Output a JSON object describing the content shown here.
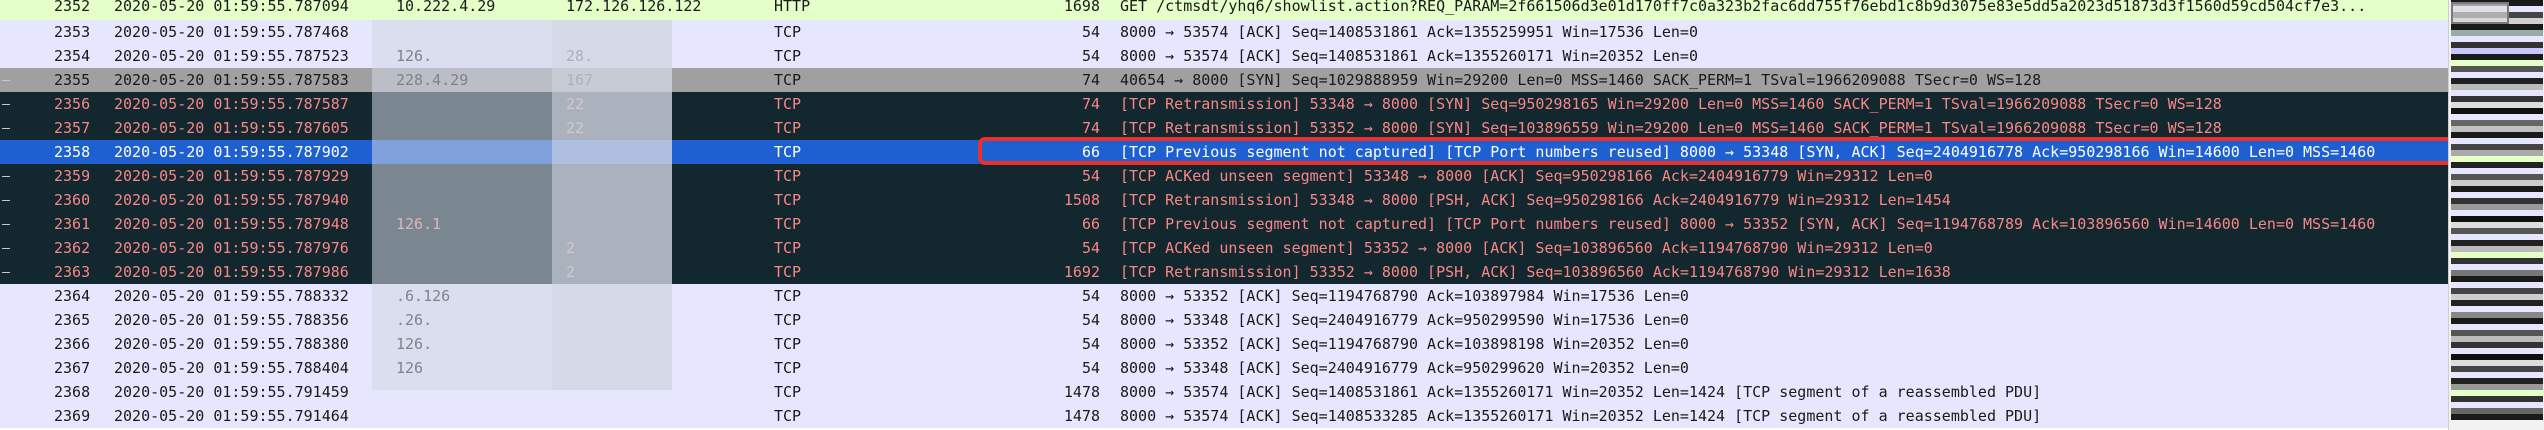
{
  "packets": [
    {
      "no": "2352",
      "time": "2020-05-20 01:59:55.787094",
      "src": "10.222.4.29",
      "dst": "172.126.126.122",
      "proto": "HTTP",
      "len": "1698",
      "info": "GET /ctmsdt/yhq6/showlist.action?REQ_PARAM=2f661506d3e01d170ff7c0a323b2fac6dd755f76ebd1c8b9d3075e83e5dd5a2023d51873d3f1560d59cd504cf7e3...",
      "style": "http"
    },
    {
      "no": "2353",
      "time": "2020-05-20 01:59:55.787468",
      "src": "",
      "dst": "",
      "proto": "TCP",
      "len": "54",
      "info": "8000 → 53574 [ACK] Seq=1408531861 Ack=1355259951 Win=17536 Len=0",
      "style": "tcp"
    },
    {
      "no": "2354",
      "time": "2020-05-20 01:59:55.787523",
      "src": "126.",
      "dst": "28.",
      "proto": "TCP",
      "len": "54",
      "info": "8000 → 53574 [ACK] Seq=1408531861 Ack=1355260171 Win=20352 Len=0",
      "style": "tcp"
    },
    {
      "no": "2355",
      "time": "2020-05-20 01:59:55.787583",
      "src": "228.4.29",
      "dst": "167",
      "proto": "TCP",
      "len": "74",
      "info": "40654 → 8000 [SYN] Seq=1029888959 Win=29200 Len=0 MSS=1460 SACK_PERM=1 TSval=1966209088 TSecr=0 WS=128",
      "style": "syn"
    },
    {
      "no": "2356",
      "time": "2020-05-20 01:59:55.787587",
      "src": "",
      "dst": "22",
      "proto": "TCP",
      "len": "74",
      "info": "[TCP Retransmission] 53348 → 8000 [SYN] Seq=950298165 Win=29200 Len=0 MSS=1460 SACK_PERM=1 TSval=1966209088 TSecr=0 WS=128",
      "style": "bad"
    },
    {
      "no": "2357",
      "time": "2020-05-20 01:59:55.787605",
      "src": "",
      "dst": "22",
      "proto": "TCP",
      "len": "74",
      "info": "[TCP Retransmission] 53352 → 8000 [SYN] Seq=103896559 Win=29200 Len=0 MSS=1460 SACK_PERM=1 TSval=1966209088 TSecr=0 WS=128",
      "style": "bad"
    },
    {
      "no": "2358",
      "time": "2020-05-20 01:59:55.787902",
      "src": "",
      "dst": "",
      "proto": "TCP",
      "len": "66",
      "info": "[TCP Previous segment not captured] [TCP Port numbers reused] 8000 → 53348 [SYN, ACK] Seq=2404916778 Ack=950298166 Win=14600 Len=0 MSS=1460",
      "style": "sel"
    },
    {
      "no": "2359",
      "time": "2020-05-20 01:59:55.787929",
      "src": "",
      "dst": "",
      "proto": "TCP",
      "len": "54",
      "info": "[TCP ACKed unseen segment] 53348 → 8000 [ACK] Seq=950298166 Ack=2404916779 Win=29312 Len=0",
      "style": "bad"
    },
    {
      "no": "2360",
      "time": "2020-05-20 01:59:55.787940",
      "src": "",
      "dst": "",
      "proto": "TCP",
      "len": "1508",
      "info": "[TCP Retransmission] 53348 → 8000 [PSH, ACK] Seq=950298166 Ack=2404916779 Win=29312 Len=1454",
      "style": "bad"
    },
    {
      "no": "2361",
      "time": "2020-05-20 01:59:55.787948",
      "src": "126.1",
      "dst": "",
      "proto": "TCP",
      "len": "66",
      "info": "[TCP Previous segment not captured] [TCP Port numbers reused] 8000 → 53352 [SYN, ACK] Seq=1194768789 Ack=103896560 Win=14600 Len=0 MSS=1460",
      "style": "bad"
    },
    {
      "no": "2362",
      "time": "2020-05-20 01:59:55.787976",
      "src": "",
      "dst": "2",
      "proto": "TCP",
      "len": "54",
      "info": "[TCP ACKed unseen segment] 53352 → 8000 [ACK] Seq=103896560 Ack=1194768790 Win=29312 Len=0",
      "style": "bad"
    },
    {
      "no": "2363",
      "time": "2020-05-20 01:59:55.787986",
      "src": "",
      "dst": "2",
      "proto": "TCP",
      "len": "1692",
      "info": "[TCP Retransmission] 53352 → 8000 [PSH, ACK] Seq=103896560 Ack=1194768790 Win=29312 Len=1638",
      "style": "bad"
    },
    {
      "no": "2364",
      "time": "2020-05-20 01:59:55.788332",
      "src": ".6.126",
      "dst": "",
      "proto": "TCP",
      "len": "54",
      "info": "8000 → 53352 [ACK] Seq=1194768790 Ack=103897984 Win=17536 Len=0",
      "style": "tcp"
    },
    {
      "no": "2365",
      "time": "2020-05-20 01:59:55.788356",
      "src": ".26.",
      "dst": "",
      "proto": "TCP",
      "len": "54",
      "info": "8000 → 53348 [ACK] Seq=2404916779 Ack=950299590 Win=17536 Len=0",
      "style": "tcp"
    },
    {
      "no": "2366",
      "time": "2020-05-20 01:59:55.788380",
      "src": "126.",
      "dst": "",
      "proto": "TCP",
      "len": "54",
      "info": "8000 → 53352 [ACK] Seq=1194768790 Ack=103898198 Win=20352 Len=0",
      "style": "tcp"
    },
    {
      "no": "2367",
      "time": "2020-05-20 01:59:55.788404",
      "src": "126",
      "dst": "",
      "proto": "TCP",
      "len": "54",
      "info": "8000 → 53348 [ACK] Seq=2404916779 Ack=950299620 Win=20352 Len=0",
      "style": "tcp"
    },
    {
      "no": "2368",
      "time": "2020-05-20 01:59:55.791459",
      "src": "",
      "dst": "",
      "proto": "TCP",
      "len": "1478",
      "info": "8000 → 53574 [ACK] Seq=1408531861 Ack=1355260171 Win=20352 Len=1424 [TCP segment of a reassembled PDU]",
      "style": "tcp"
    },
    {
      "no": "2369",
      "time": "2020-05-20 01:59:55.791464",
      "src": "",
      "dst": "",
      "proto": "TCP",
      "len": "1478",
      "info": "8000 → 53574 [ACK] Seq=1408533285 Ack=1355260171 Win=20352 Len=1424 [TCP segment of a reassembled PDU]",
      "style": "tcp"
    }
  ],
  "colors": {
    "http": "#e4ffc7",
    "tcp": "#e7e6ff",
    "syn": "#a0a0a0",
    "bad": "#12272e",
    "bad_text": "#f78787",
    "selected": "#1e5fd2",
    "highlight_box": "#e8312a"
  },
  "minimap_pattern": [
    "#1a1a1a",
    "#e7e6ff",
    "#444",
    "#d0d0d0",
    "#1a1a1a",
    "#9aa",
    "#e7e6ff",
    "#333",
    "#c8c8ff",
    "#1a1a1a",
    "#e4ffc7",
    "#555",
    "#e7e6ff",
    "#222",
    "#bbb",
    "#e7e6ff",
    "#333",
    "#ddd",
    "#111",
    "#e7e6ff",
    "#666",
    "#c0c0c0",
    "#1a1a1a",
    "#e7e6ff",
    "#444",
    "#aaa",
    "#e4ffc7",
    "#222",
    "#e7e6ff",
    "#555",
    "#ccc",
    "#1a1a1a",
    "#e7e6ff",
    "#333",
    "#999",
    "#e7e6ff",
    "#111",
    "#ddd",
    "#555",
    "#e7e6ff",
    "#222",
    "#bbb",
    "#e4ffc7",
    "#333",
    "#e7e6ff",
    "#777",
    "#1a1a1a",
    "#e7e6ff",
    "#444",
    "#ccc",
    "#222",
    "#e7e6ff",
    "#888",
    "#1a1a1a",
    "#e7e6ff",
    "#555",
    "#bbb",
    "#333",
    "#e7e6ff",
    "#111",
    "#ddd",
    "#444",
    "#e7e6ff",
    "#222",
    "#999",
    "#e4ffc7",
    "#333",
    "#e7e6ff",
    "#666",
    "#1a1a1a"
  ]
}
